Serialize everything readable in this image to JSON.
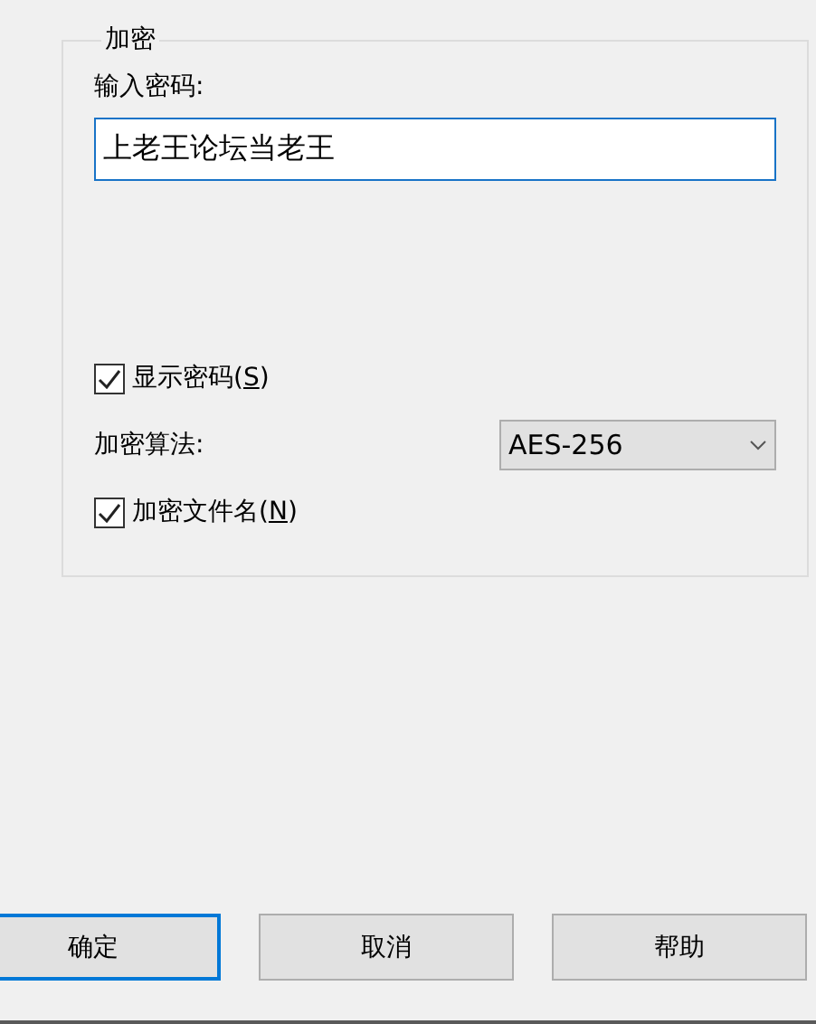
{
  "group": {
    "title": "加密",
    "password_label": "输入密码:",
    "password": {
      "value": "上老王论坛当老王",
      "focused": true
    },
    "options": [
      {
        "kind": "checkbox",
        "parts": [
          "显示密码(",
          "S",
          ")"
        ],
        "checked": true
      },
      {
        "kind": "select",
        "label": "加密算法:",
        "value": "AES-256"
      },
      {
        "kind": "checkbox",
        "parts": [
          "加密文件名(",
          "N",
          ")"
        ],
        "checked": true
      }
    ]
  },
  "buttons": [
    {
      "label": "确定",
      "default": true
    },
    {
      "label": "取消",
      "default": false
    },
    {
      "label": "帮助",
      "default": false
    }
  ]
}
